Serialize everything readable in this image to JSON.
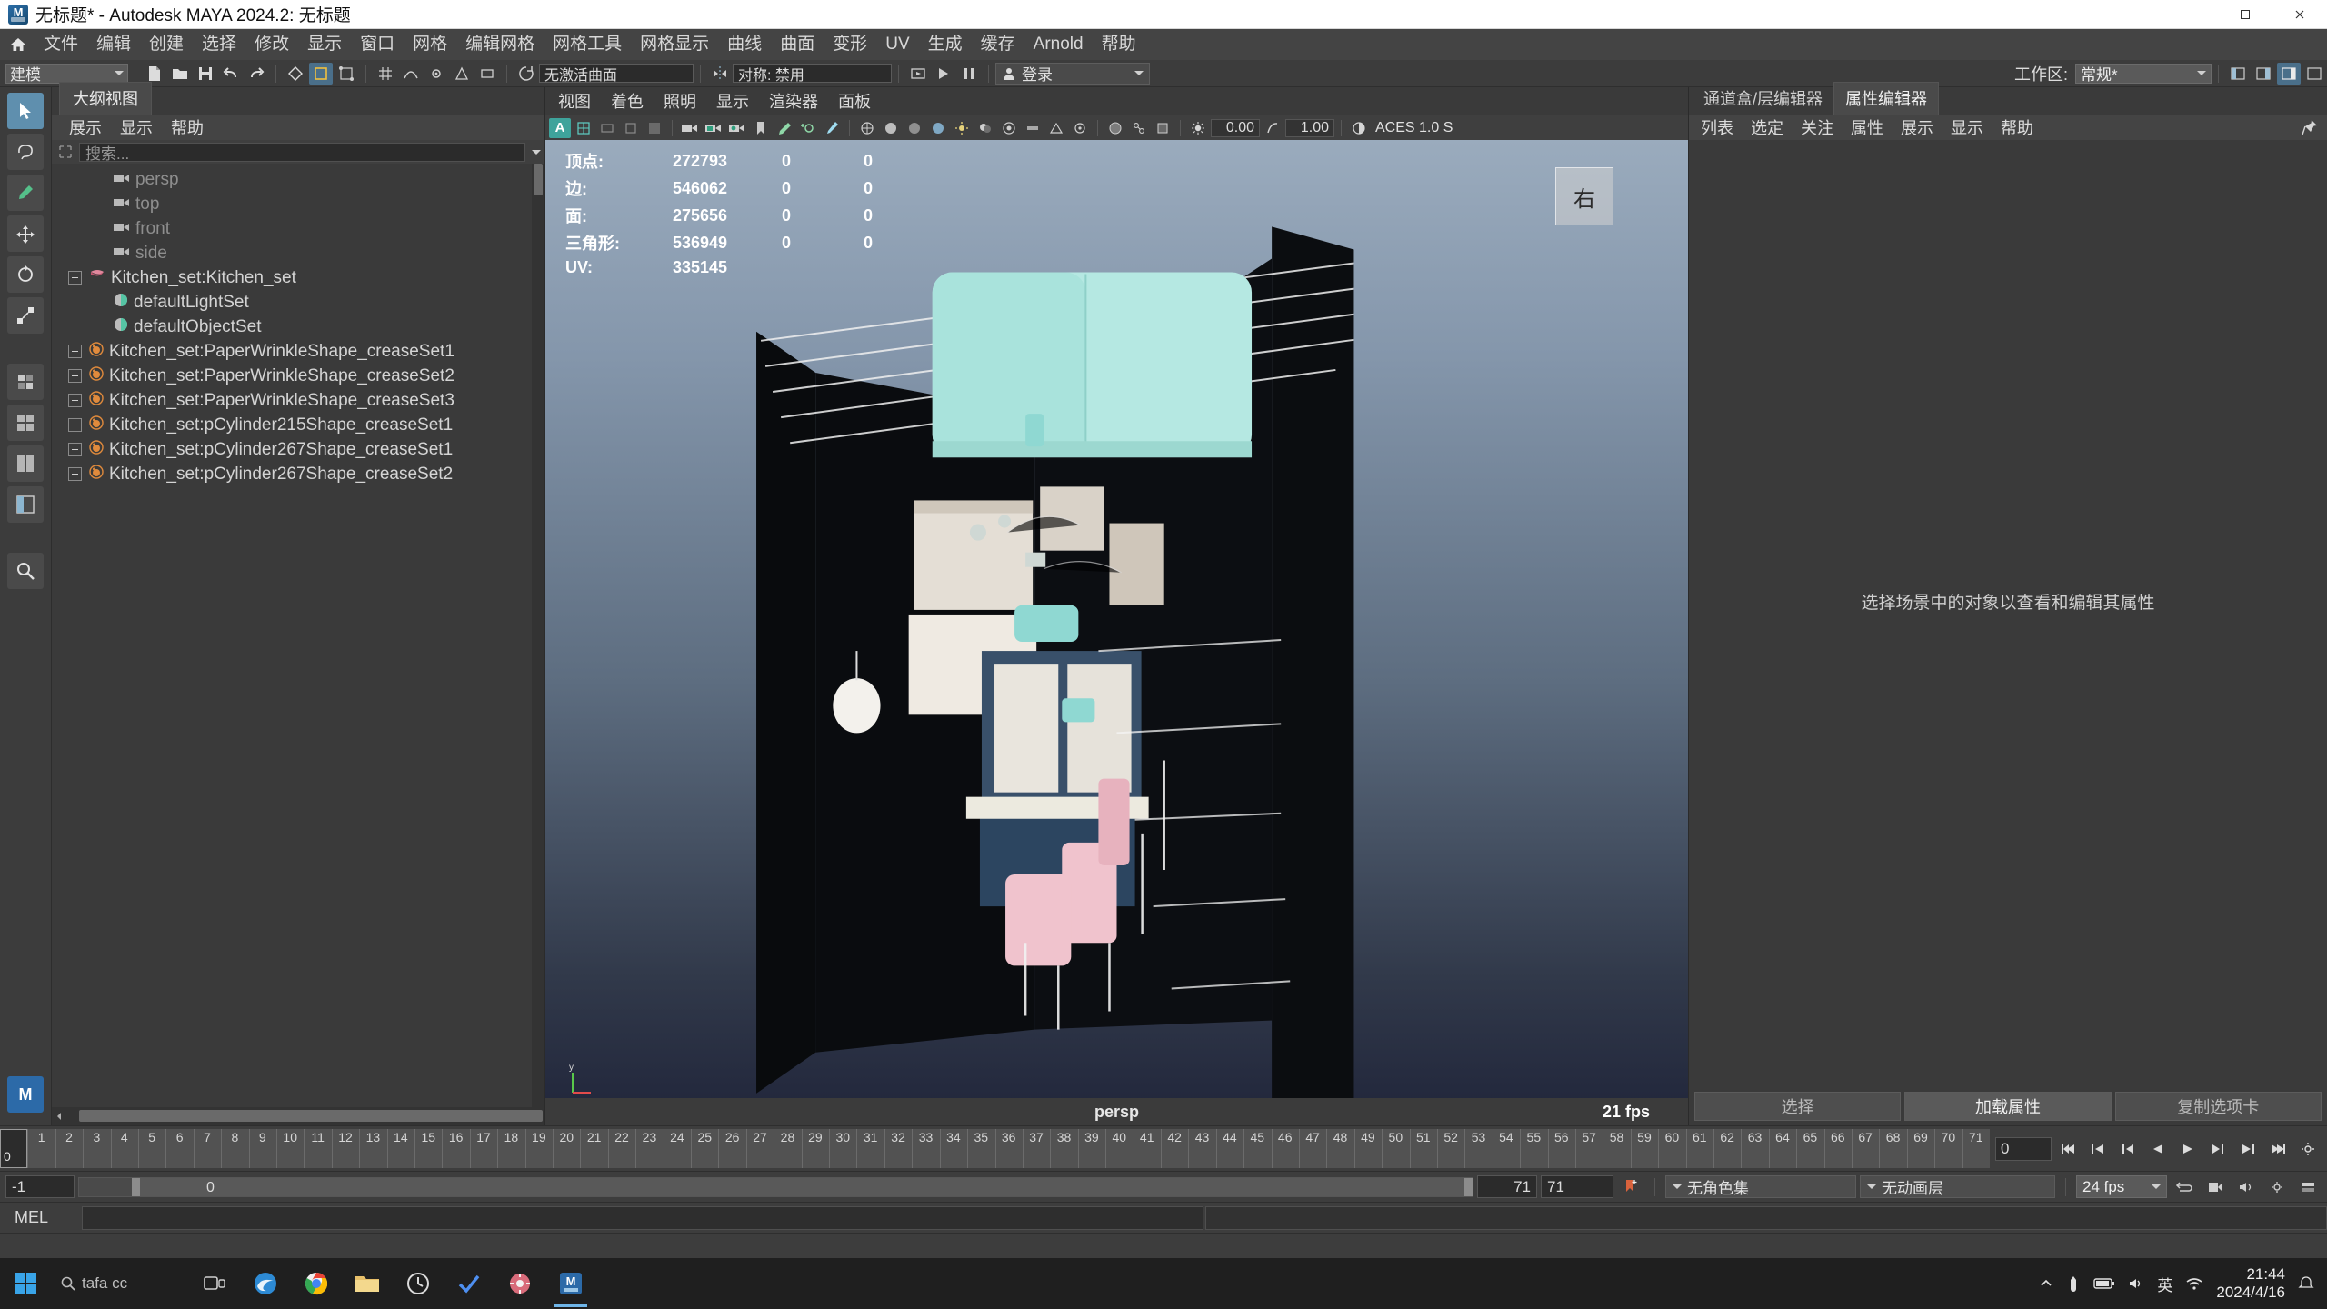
{
  "window": {
    "title": "无标题* - Autodesk MAYA 2024.2: 无标题",
    "minimize": "—",
    "maximize": "▢",
    "close": "✕"
  },
  "menubar": {
    "home_icon": "home-icon",
    "items": [
      "文件",
      "编辑",
      "创建",
      "选择",
      "修改",
      "显示",
      "窗口",
      "网格",
      "编辑网格",
      "网格工具",
      "网格显示",
      "曲线",
      "曲面",
      "变形",
      "UV",
      "生成",
      "缓存",
      "Arnold",
      "帮助"
    ]
  },
  "toolbar": {
    "mode_select": "建模",
    "symmetry_label": "对称: 禁用",
    "live_surface": "无激活曲面",
    "login_label": "登录",
    "workspace_label": "工作区:",
    "workspace_value": "常规*"
  },
  "outliner": {
    "tab": "大纲视图",
    "menus": [
      "展示",
      "显示",
      "帮助"
    ],
    "search_placeholder": "搜索...",
    "items": [
      {
        "label": "persp",
        "icon": "camera-icon",
        "expandable": false,
        "dim": true,
        "indent": 1
      },
      {
        "label": "top",
        "icon": "camera-icon",
        "expandable": false,
        "dim": true,
        "indent": 1
      },
      {
        "label": "front",
        "icon": "camera-icon",
        "expandable": false,
        "dim": true,
        "indent": 1
      },
      {
        "label": "side",
        "icon": "camera-icon",
        "expandable": false,
        "dim": true,
        "indent": 1
      },
      {
        "label": "Kitchen_set:Kitchen_set",
        "icon": "set-icon",
        "expandable": true,
        "dim": false,
        "indent": 0
      },
      {
        "label": "defaultLightSet",
        "icon": "lightset-icon",
        "expandable": false,
        "dim": false,
        "indent": 1
      },
      {
        "label": "defaultObjectSet",
        "icon": "objectset-icon",
        "expandable": false,
        "dim": false,
        "indent": 1
      },
      {
        "label": "Kitchen_set:PaperWrinkleShape_creaseSet1",
        "icon": "creaseset-icon",
        "expandable": true,
        "dim": false,
        "indent": 0
      },
      {
        "label": "Kitchen_set:PaperWrinkleShape_creaseSet2",
        "icon": "creaseset-icon",
        "expandable": true,
        "dim": false,
        "indent": 0
      },
      {
        "label": "Kitchen_set:PaperWrinkleShape_creaseSet3",
        "icon": "creaseset-icon",
        "expandable": true,
        "dim": false,
        "indent": 0
      },
      {
        "label": "Kitchen_set:pCylinder215Shape_creaseSet1",
        "icon": "creaseset-icon",
        "expandable": true,
        "dim": false,
        "indent": 0
      },
      {
        "label": "Kitchen_set:pCylinder267Shape_creaseSet1",
        "icon": "creaseset-icon",
        "expandable": true,
        "dim": false,
        "indent": 0
      },
      {
        "label": "Kitchen_set:pCylinder267Shape_creaseSet2",
        "icon": "creaseset-icon",
        "expandable": true,
        "dim": false,
        "indent": 0
      }
    ]
  },
  "viewport": {
    "panel_menus": [
      "视图",
      "着色",
      "照明",
      "显示",
      "渲染器",
      "面板"
    ],
    "gamma": "0.00",
    "exposure": "1.00",
    "color_space": "ACES 1.0 S",
    "view_cube_label": "右",
    "camera_label": "persp",
    "fps_label": "21 fps",
    "axis_y": "y",
    "hud": {
      "rows": [
        {
          "label": "顶点:",
          "value": "272793",
          "c2": "0",
          "c3": "0"
        },
        {
          "label": "边:",
          "value": "546062",
          "c2": "0",
          "c3": "0"
        },
        {
          "label": "面:",
          "value": "275656",
          "c2": "0",
          "c3": "0"
        },
        {
          "label": "三角形:",
          "value": "536949",
          "c2": "0",
          "c3": "0"
        },
        {
          "label": "UV:",
          "value": "335145",
          "c2": "",
          "c3": ""
        }
      ]
    }
  },
  "right_panel": {
    "tabs": [
      {
        "label": "通道盒/层编辑器",
        "active": false
      },
      {
        "label": "属性编辑器",
        "active": true
      }
    ],
    "menus": [
      "列表",
      "选定",
      "关注",
      "属性",
      "展示",
      "显示",
      "帮助"
    ],
    "hint": "选择场景中的对象以查看和编辑其属性",
    "buttons": [
      {
        "label": "选择",
        "emphasis": false
      },
      {
        "label": "加载属性",
        "emphasis": true
      },
      {
        "label": "复制选项卡",
        "emphasis": false
      }
    ]
  },
  "timeline": {
    "start_tick": 0,
    "end_tick": 71,
    "current_frame": "0",
    "current_frame_field": "0",
    "tick_labels": [
      0,
      1,
      2,
      3,
      4,
      5,
      6,
      7,
      8,
      9,
      10,
      11,
      12,
      13,
      14,
      15,
      16,
      17,
      18,
      19,
      20,
      21,
      22,
      23,
      24,
      25,
      26,
      27,
      28,
      29,
      30,
      31,
      32,
      33,
      34,
      35,
      36,
      37,
      38,
      39,
      40,
      41,
      42,
      43,
      44,
      45,
      46,
      47,
      48,
      49,
      50,
      51,
      52,
      53,
      54,
      55,
      56,
      57,
      58,
      59,
      60,
      61,
      62,
      63,
      64,
      65,
      66,
      67,
      68,
      69,
      70,
      71
    ],
    "transport": [
      "go-to-start",
      "step-back-key",
      "step-back-frame",
      "play-backwards",
      "play-forwards",
      "step-forward-frame",
      "step-forward-key",
      "go-to-end"
    ]
  },
  "range": {
    "range_start": "-1",
    "anim_start": "0",
    "anim_end": "71",
    "range_end": "71",
    "character_set": "无角色集",
    "anim_layer": "无动画层",
    "fps": "24 fps"
  },
  "command_line": {
    "language": "MEL",
    "input_value": "",
    "output_value": ""
  },
  "taskbar": {
    "search_placeholder": "tafa cc",
    "apps": [
      "start-icon",
      "search-icon",
      "task-view-icon",
      "edge-icon",
      "chrome-icon",
      "folder-icon",
      "clock-icon",
      "todo-icon",
      "settings-icon",
      "maya-icon"
    ],
    "time": "21:44",
    "date": "2024/4/16",
    "ime": "英"
  },
  "colors": {
    "accent": "#5f8fae",
    "panel_bg": "#3a3a3a",
    "menu_bg": "#444444",
    "teal": "#3ea39b",
    "orange": "#e08a3c"
  }
}
